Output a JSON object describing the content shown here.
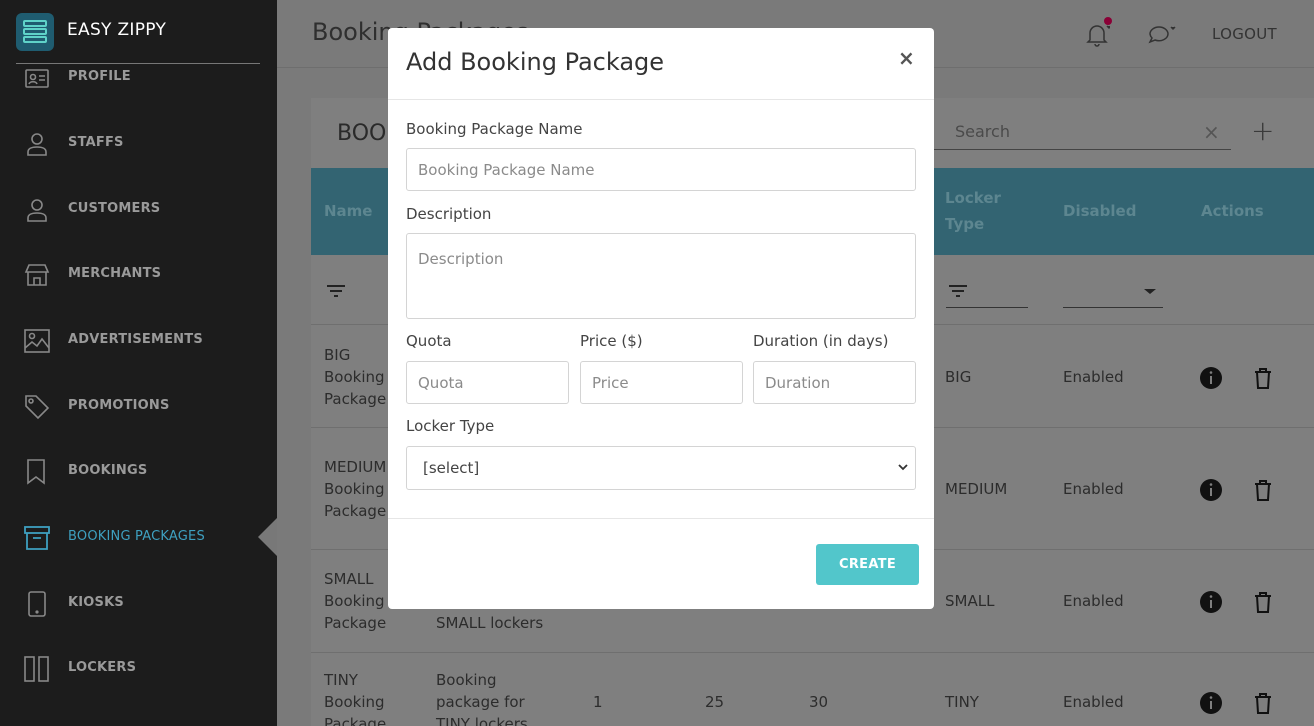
{
  "app": {
    "brand_name": "EASY ZIPPY"
  },
  "sidebar": {
    "items": [
      {
        "label": "PROFILE",
        "icon": "id-card-icon"
      },
      {
        "label": "STAFFS",
        "icon": "user-icon"
      },
      {
        "label": "CUSTOMERS",
        "icon": "user-icon"
      },
      {
        "label": "MERCHANTS",
        "icon": "store-icon"
      },
      {
        "label": "ADVERTISEMENTS",
        "icon": "image-icon"
      },
      {
        "label": "PROMOTIONS",
        "icon": "tag-icon"
      },
      {
        "label": "BOOKINGS",
        "icon": "bookmark-icon"
      },
      {
        "label": "BOOKING PACKAGES",
        "icon": "archive-icon",
        "active": true
      },
      {
        "label": "KIOSKS",
        "icon": "mobile-icon"
      },
      {
        "label": "LOCKERS",
        "icon": "locker-icon"
      }
    ]
  },
  "header": {
    "title": "Booking Packages",
    "logout_label": "LOGOUT"
  },
  "card": {
    "title": "BOOKING PACKAGES",
    "search_placeholder": "Search",
    "columns": {
      "name": "Name",
      "locker_type_line1": "Locker",
      "locker_type_line2": "Type",
      "disabled": "Disabled",
      "actions": "Actions"
    },
    "rows": [
      {
        "name": [
          "BIG",
          "Booking",
          "Package"
        ],
        "description": [],
        "quota": "",
        "price": "",
        "duration": "",
        "locker_type": "BIG",
        "disabled": "Enabled"
      },
      {
        "name": [
          "MEDIUM",
          "Booking",
          "Package"
        ],
        "description": [],
        "quota": "",
        "price": "",
        "duration": "",
        "locker_type": "MEDIUM",
        "disabled": "Enabled"
      },
      {
        "name": [
          "SMALL",
          "Booking",
          "Package"
        ],
        "description": [
          "",
          "",
          "SMALL lockers"
        ],
        "quota": "",
        "price": "",
        "duration": "",
        "locker_type": "SMALL",
        "disabled": "Enabled"
      },
      {
        "name": [
          "TINY",
          "Booking",
          "Package"
        ],
        "description": [
          "Booking",
          "package for",
          "TINY lockers"
        ],
        "quota": "1",
        "price": "25",
        "duration": "30",
        "locker_type": "TINY",
        "disabled": "Enabled"
      }
    ]
  },
  "modal": {
    "title": "Add Booking Package",
    "close_label": "×",
    "name_label": "Booking Package Name",
    "name_placeholder": "Booking Package Name",
    "description_label": "Description",
    "description_placeholder": "Description",
    "quota_label": "Quota",
    "quota_placeholder": "Quota",
    "price_label": "Price ($)",
    "price_placeholder": "Price",
    "duration_label": "Duration (in days)",
    "duration_placeholder": "Duration",
    "locker_type_label": "Locker Type",
    "locker_type_value": "[select]",
    "create_label": "CREATE"
  },
  "colors": {
    "accent": "#52c6cb",
    "active_nav": "#3ea0c0",
    "notification_dot": "#8a0036"
  }
}
